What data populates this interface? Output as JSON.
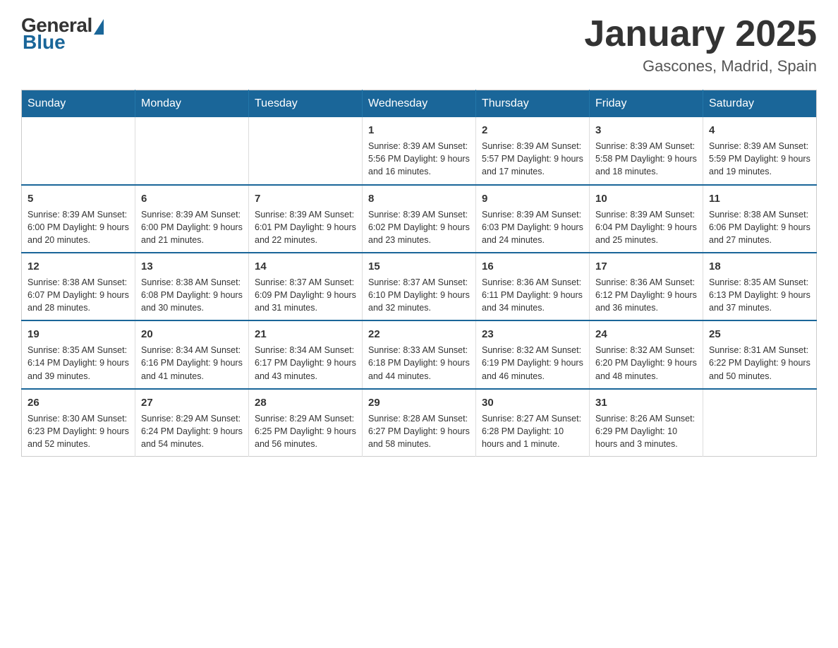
{
  "logo": {
    "general": "General",
    "blue": "Blue"
  },
  "header": {
    "title": "January 2025",
    "subtitle": "Gascones, Madrid, Spain"
  },
  "calendar": {
    "days": [
      "Sunday",
      "Monday",
      "Tuesday",
      "Wednesday",
      "Thursday",
      "Friday",
      "Saturday"
    ],
    "weeks": [
      [
        {
          "day": "",
          "info": ""
        },
        {
          "day": "",
          "info": ""
        },
        {
          "day": "",
          "info": ""
        },
        {
          "day": "1",
          "info": "Sunrise: 8:39 AM\nSunset: 5:56 PM\nDaylight: 9 hours\nand 16 minutes."
        },
        {
          "day": "2",
          "info": "Sunrise: 8:39 AM\nSunset: 5:57 PM\nDaylight: 9 hours\nand 17 minutes."
        },
        {
          "day": "3",
          "info": "Sunrise: 8:39 AM\nSunset: 5:58 PM\nDaylight: 9 hours\nand 18 minutes."
        },
        {
          "day": "4",
          "info": "Sunrise: 8:39 AM\nSunset: 5:59 PM\nDaylight: 9 hours\nand 19 minutes."
        }
      ],
      [
        {
          "day": "5",
          "info": "Sunrise: 8:39 AM\nSunset: 6:00 PM\nDaylight: 9 hours\nand 20 minutes."
        },
        {
          "day": "6",
          "info": "Sunrise: 8:39 AM\nSunset: 6:00 PM\nDaylight: 9 hours\nand 21 minutes."
        },
        {
          "day": "7",
          "info": "Sunrise: 8:39 AM\nSunset: 6:01 PM\nDaylight: 9 hours\nand 22 minutes."
        },
        {
          "day": "8",
          "info": "Sunrise: 8:39 AM\nSunset: 6:02 PM\nDaylight: 9 hours\nand 23 minutes."
        },
        {
          "day": "9",
          "info": "Sunrise: 8:39 AM\nSunset: 6:03 PM\nDaylight: 9 hours\nand 24 minutes."
        },
        {
          "day": "10",
          "info": "Sunrise: 8:39 AM\nSunset: 6:04 PM\nDaylight: 9 hours\nand 25 minutes."
        },
        {
          "day": "11",
          "info": "Sunrise: 8:38 AM\nSunset: 6:06 PM\nDaylight: 9 hours\nand 27 minutes."
        }
      ],
      [
        {
          "day": "12",
          "info": "Sunrise: 8:38 AM\nSunset: 6:07 PM\nDaylight: 9 hours\nand 28 minutes."
        },
        {
          "day": "13",
          "info": "Sunrise: 8:38 AM\nSunset: 6:08 PM\nDaylight: 9 hours\nand 30 minutes."
        },
        {
          "day": "14",
          "info": "Sunrise: 8:37 AM\nSunset: 6:09 PM\nDaylight: 9 hours\nand 31 minutes."
        },
        {
          "day": "15",
          "info": "Sunrise: 8:37 AM\nSunset: 6:10 PM\nDaylight: 9 hours\nand 32 minutes."
        },
        {
          "day": "16",
          "info": "Sunrise: 8:36 AM\nSunset: 6:11 PM\nDaylight: 9 hours\nand 34 minutes."
        },
        {
          "day": "17",
          "info": "Sunrise: 8:36 AM\nSunset: 6:12 PM\nDaylight: 9 hours\nand 36 minutes."
        },
        {
          "day": "18",
          "info": "Sunrise: 8:35 AM\nSunset: 6:13 PM\nDaylight: 9 hours\nand 37 minutes."
        }
      ],
      [
        {
          "day": "19",
          "info": "Sunrise: 8:35 AM\nSunset: 6:14 PM\nDaylight: 9 hours\nand 39 minutes."
        },
        {
          "day": "20",
          "info": "Sunrise: 8:34 AM\nSunset: 6:16 PM\nDaylight: 9 hours\nand 41 minutes."
        },
        {
          "day": "21",
          "info": "Sunrise: 8:34 AM\nSunset: 6:17 PM\nDaylight: 9 hours\nand 43 minutes."
        },
        {
          "day": "22",
          "info": "Sunrise: 8:33 AM\nSunset: 6:18 PM\nDaylight: 9 hours\nand 44 minutes."
        },
        {
          "day": "23",
          "info": "Sunrise: 8:32 AM\nSunset: 6:19 PM\nDaylight: 9 hours\nand 46 minutes."
        },
        {
          "day": "24",
          "info": "Sunrise: 8:32 AM\nSunset: 6:20 PM\nDaylight: 9 hours\nand 48 minutes."
        },
        {
          "day": "25",
          "info": "Sunrise: 8:31 AM\nSunset: 6:22 PM\nDaylight: 9 hours\nand 50 minutes."
        }
      ],
      [
        {
          "day": "26",
          "info": "Sunrise: 8:30 AM\nSunset: 6:23 PM\nDaylight: 9 hours\nand 52 minutes."
        },
        {
          "day": "27",
          "info": "Sunrise: 8:29 AM\nSunset: 6:24 PM\nDaylight: 9 hours\nand 54 minutes."
        },
        {
          "day": "28",
          "info": "Sunrise: 8:29 AM\nSunset: 6:25 PM\nDaylight: 9 hours\nand 56 minutes."
        },
        {
          "day": "29",
          "info": "Sunrise: 8:28 AM\nSunset: 6:27 PM\nDaylight: 9 hours\nand 58 minutes."
        },
        {
          "day": "30",
          "info": "Sunrise: 8:27 AM\nSunset: 6:28 PM\nDaylight: 10 hours\nand 1 minute."
        },
        {
          "day": "31",
          "info": "Sunrise: 8:26 AM\nSunset: 6:29 PM\nDaylight: 10 hours\nand 3 minutes."
        },
        {
          "day": "",
          "info": ""
        }
      ]
    ]
  }
}
